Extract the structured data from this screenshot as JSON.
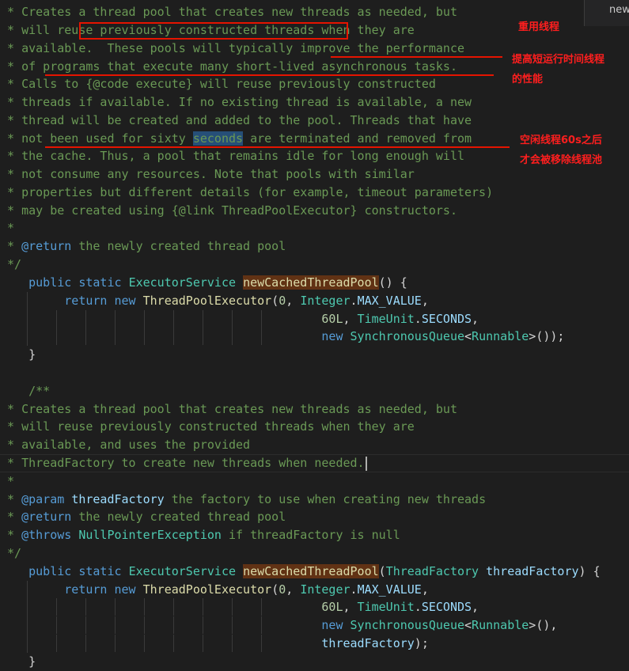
{
  "tab_partial": "new",
  "annotations": {
    "reuse": "重用线程",
    "perf_line1": "提高短运行时间线程",
    "perf_line2": "的性能",
    "idle_line1": "空闲线程60s之后",
    "idle_line2": "才会被移除线程池"
  },
  "code": {
    "doc1": {
      "l1": " * Creates a thread pool that creates new threads as needed, but",
      "l2_pre": " * will ",
      "l2_box": "reuse previously constructed threads",
      "l2_post": " when they are",
      "l3_pre": " * available.  These pools will typically ",
      "l3_ul": "improve the performance",
      "l4_pre": " * ",
      "l4_ul": "of programs that execute many short-lived asynchronous tasks.",
      "l5": " * Calls to {@code execute} will reuse previously constructed",
      "l6": " * threads if available. If no existing thread is available, a new",
      "l7": " * thread will be created and added to the pool. Threads that have",
      "l8_pre": " * ",
      "l8_a": "not been used for sixty ",
      "l8_word": "seconds",
      "l8_b": " are terminated and removed from",
      "l9": " * the cache. Thus, a pool that remains idle for long enough will",
      "l10": " * not consume any resources. Note that pools with similar",
      "l11": " * properties but different details (for example, timeout parameters)",
      "l12": " * may be created using {@link ThreadPoolExecutor} constructors.",
      "l13": " *",
      "l14_pre": " * ",
      "l14_tag": "@return",
      "l14_text": " the newly created thread pool",
      "l15": " */"
    },
    "m1": {
      "public": "public",
      "static": "static",
      "rtype": "ExecutorService",
      "name": "newCachedThreadPool",
      "sig_rest": "() {",
      "ret": "return",
      "new": "new",
      "ctor": "ThreadPoolExecutor",
      "arg0": "0",
      "integer": "Integer",
      "maxv": "MAX_VALUE",
      "arg60": "60L",
      "timeunit": "TimeUnit",
      "seconds": "SECONDS",
      "new2": "new",
      "sq": "SynchronousQueue",
      "runnable": "Runnable",
      "end1": ">());",
      "close": "}"
    },
    "doc2": {
      "open": "/**",
      "l1": " * Creates a thread pool that creates new threads as needed, but",
      "l2": " * will reuse previously constructed threads when they are",
      "l3": " * available, and uses the provided",
      "l4": " * ThreadFactory to create new threads when needed.",
      "l5": " *",
      "l6_tag": "@param",
      "l6_name": "threadFactory",
      "l6_text": " the factory to use when creating new threads",
      "l7_tag": "@return",
      "l7_text": " the newly created thread pool",
      "l8_tag": "@throws",
      "l8_type": "NullPointerException",
      "l8_text": " if threadFactory is null",
      "l9": " */"
    },
    "m2": {
      "ptype": "ThreadFactory",
      "pname": "threadFactory",
      "end1": ">(),",
      "tf": "threadFactory",
      "end2": ");"
    }
  }
}
